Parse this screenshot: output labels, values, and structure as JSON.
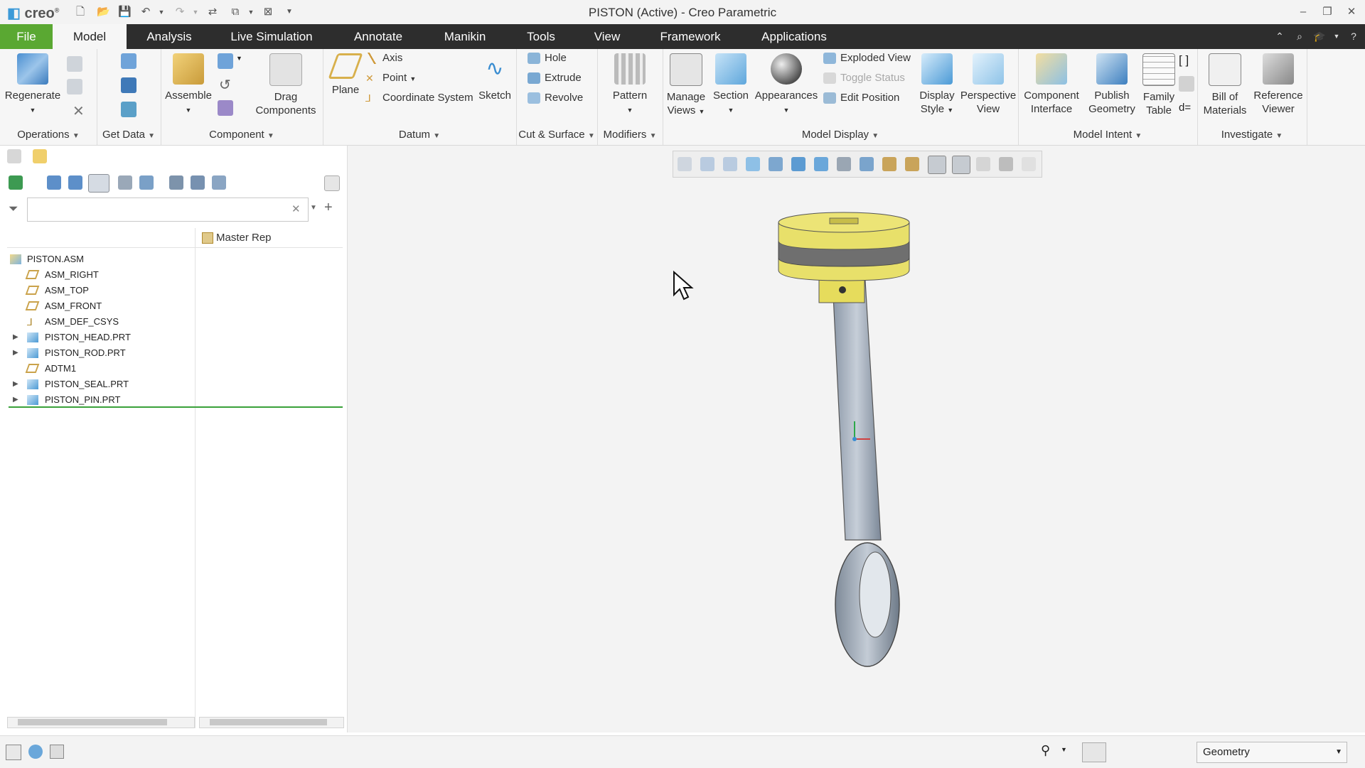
{
  "window": {
    "title": "PISTON (Active) - Creo Parametric",
    "logo_text": "creo"
  },
  "menu": {
    "tabs": [
      "File",
      "Model",
      "Analysis",
      "Live Simulation",
      "Annotate",
      "Manikin",
      "Tools",
      "View",
      "Framework",
      "Applications"
    ],
    "active_tab": "Model"
  },
  "ribbon": {
    "operations": {
      "regenerate": "Regenerate",
      "label": "Operations"
    },
    "get_data": {
      "label": "Get Data"
    },
    "component": {
      "assemble": "Assemble",
      "drag": [
        "Drag",
        "Components"
      ],
      "label": "Component"
    },
    "datum": {
      "plane": "Plane",
      "axis": "Axis",
      "point": "Point",
      "csys": "Coordinate System",
      "sketch": "Sketch",
      "label": "Datum"
    },
    "cut_surface": {
      "hole": "Hole",
      "extrude": "Extrude",
      "revolve": "Revolve",
      "label": "Cut & Surface"
    },
    "modifiers": {
      "pattern": "Pattern",
      "label": "Modifiers"
    },
    "model_display": {
      "manage_views": [
        "Manage",
        "Views"
      ],
      "section": "Section",
      "appearances": "Appearances",
      "exploded_view": "Exploded View",
      "toggle_status": "Toggle Status",
      "edit_position": "Edit Position",
      "display_style": [
        "Display",
        "Style"
      ],
      "perspective_view": [
        "Perspective",
        "View"
      ],
      "label": "Model Display"
    },
    "model_intent": {
      "component_interface": [
        "Component",
        "Interface"
      ],
      "publish_geometry": [
        "Publish",
        "Geometry"
      ],
      "family_table": [
        "Family",
        "Table"
      ],
      "label": "Model Intent"
    },
    "investigate": {
      "bom": [
        "Bill of",
        "Materials"
      ],
      "reference_viewer": [
        "Reference",
        "Viewer"
      ],
      "label": "Investigate"
    }
  },
  "model_tree": {
    "column_header": "Master Rep",
    "search_placeholder": "",
    "items": [
      {
        "label": "PISTON.ASM",
        "type": "assembly",
        "level": 0,
        "expandable": false
      },
      {
        "label": "ASM_RIGHT",
        "type": "plane",
        "level": 1,
        "expandable": false
      },
      {
        "label": "ASM_TOP",
        "type": "plane",
        "level": 1,
        "expandable": false
      },
      {
        "label": "ASM_FRONT",
        "type": "plane",
        "level": 1,
        "expandable": false
      },
      {
        "label": "ASM_DEF_CSYS",
        "type": "csys",
        "level": 1,
        "expandable": false
      },
      {
        "label": "PISTON_HEAD.PRT",
        "type": "part",
        "level": 1,
        "expandable": true
      },
      {
        "label": "PISTON_ROD.PRT",
        "type": "part",
        "level": 1,
        "expandable": true
      },
      {
        "label": "ADTM1",
        "type": "plane",
        "level": 1,
        "expandable": false
      },
      {
        "label": "PISTON_SEAL.PRT",
        "type": "part",
        "level": 1,
        "expandable": true
      },
      {
        "label": "PISTON_PIN.PRT",
        "type": "part",
        "level": 1,
        "expandable": true
      }
    ]
  },
  "status_bar": {
    "selection_filter": "Geometry"
  },
  "colors": {
    "file_tab": "#5aa832",
    "menubar": "#2d2d2d",
    "viewport_bg": "#f3f3f3",
    "piston_head": "#e8e06a",
    "rod": "#a9b4c2"
  }
}
